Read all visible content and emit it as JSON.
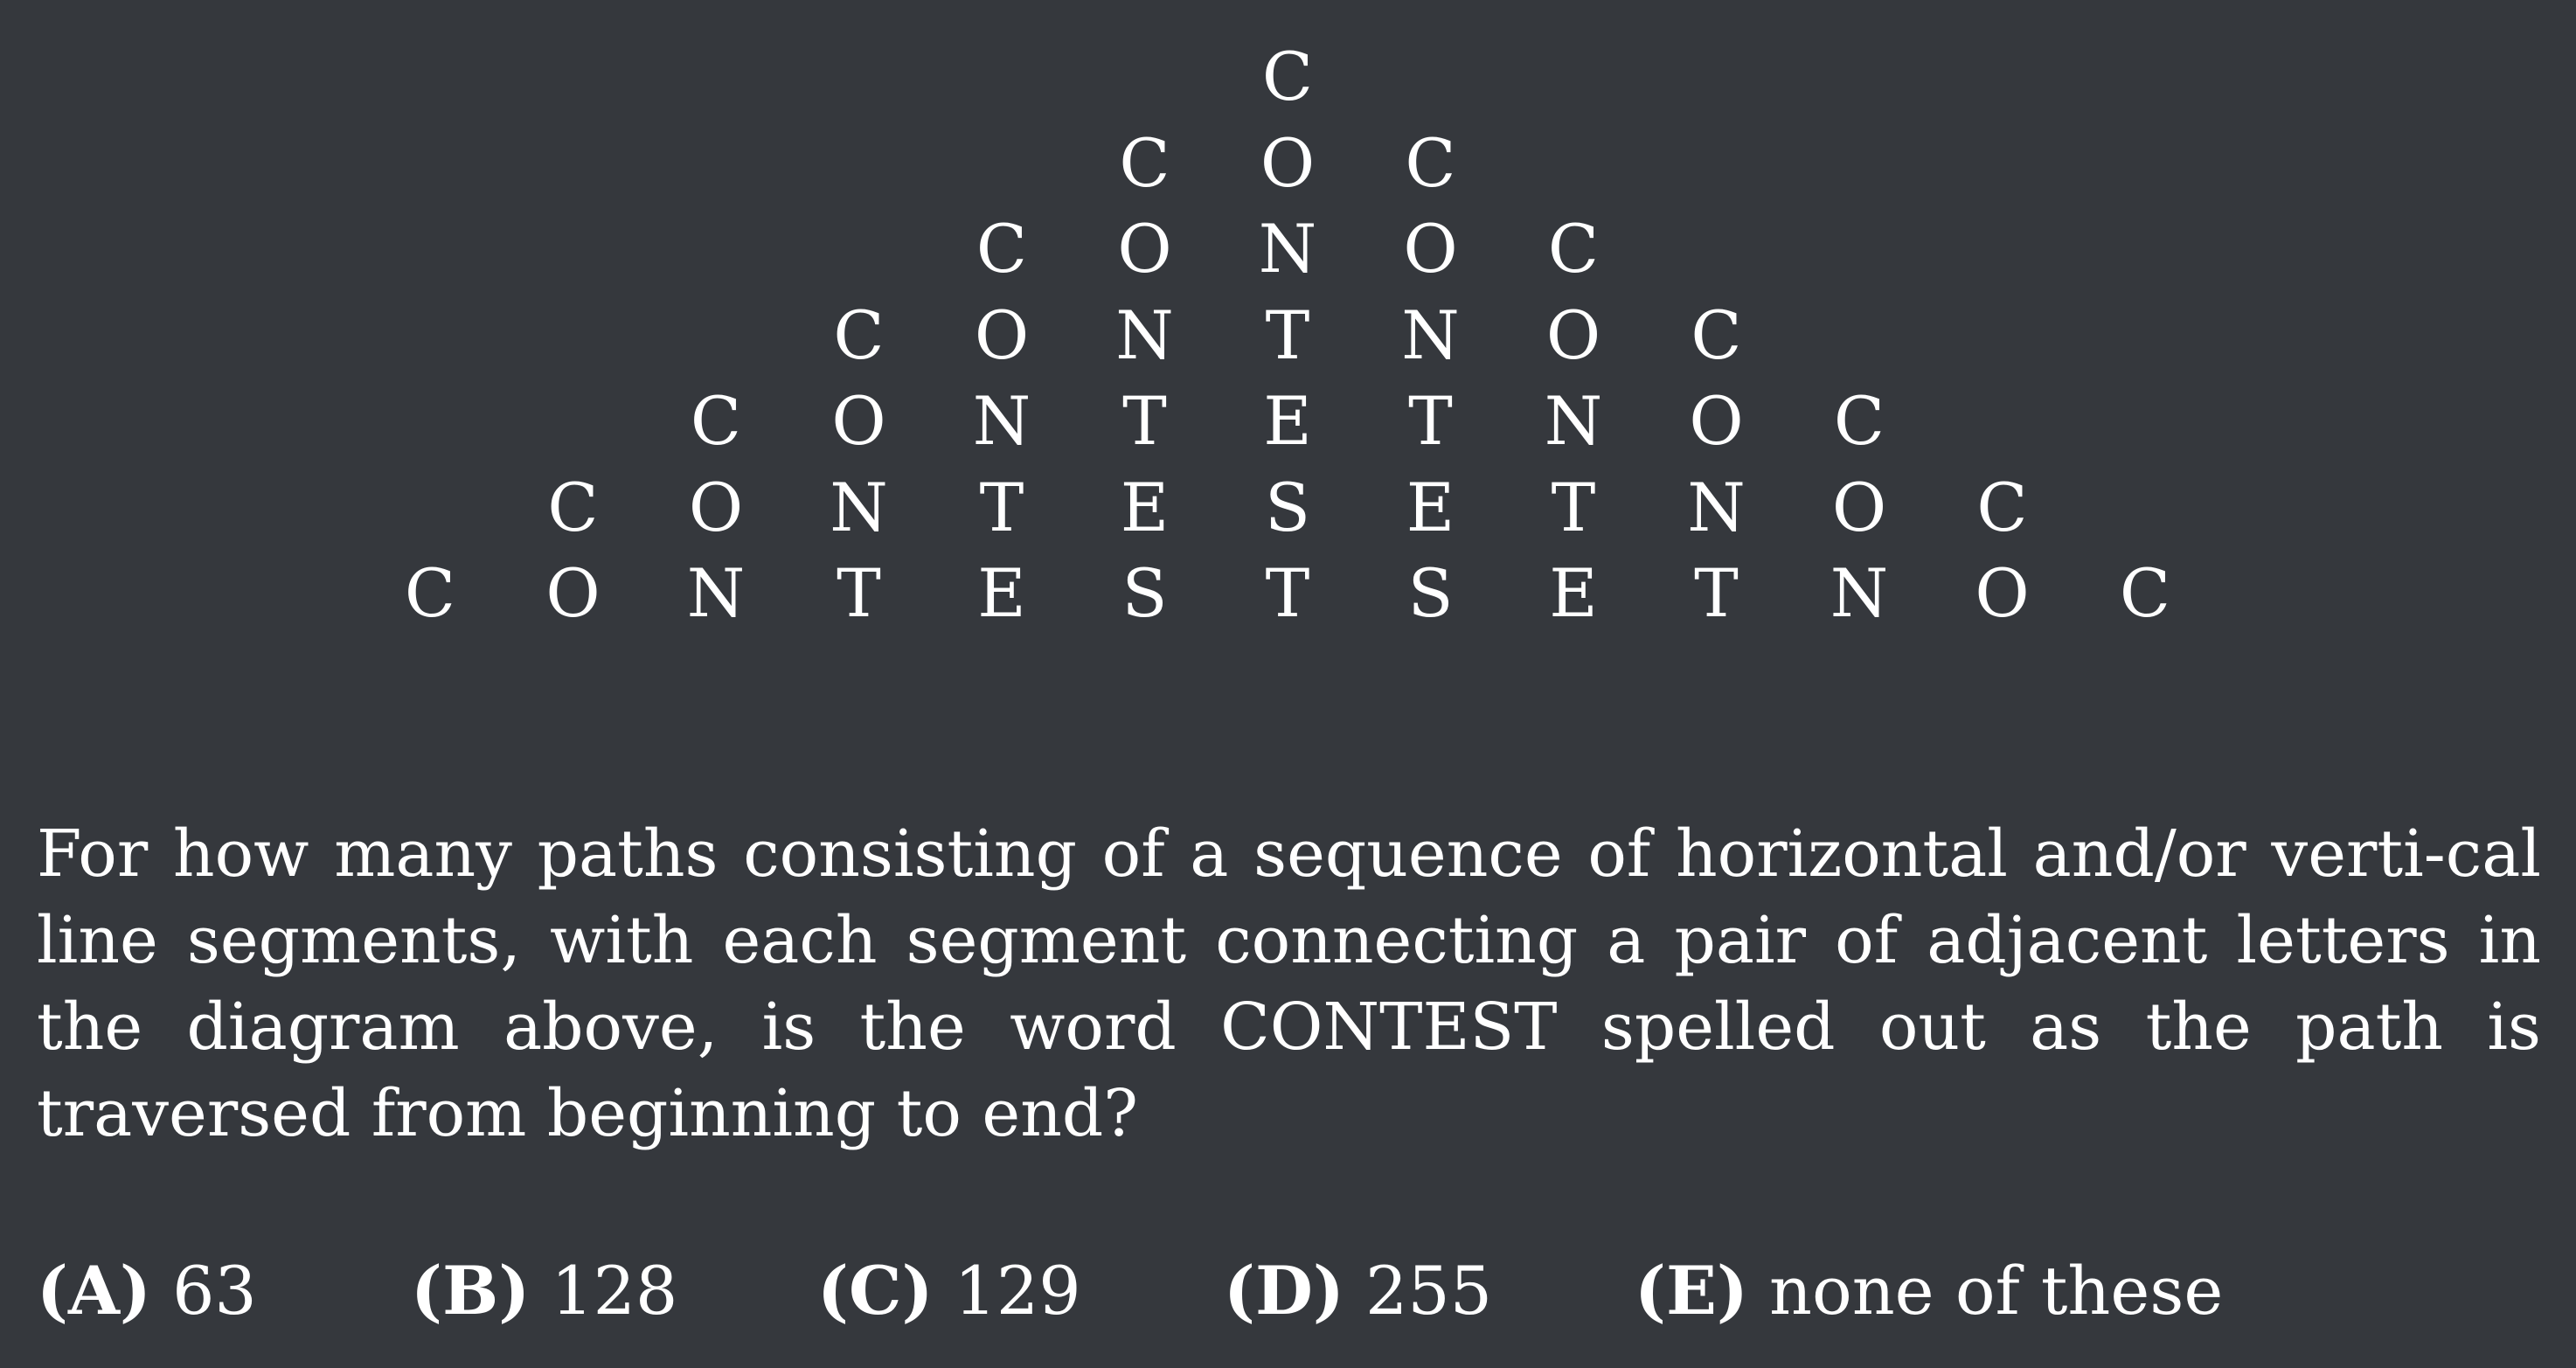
{
  "diagram": {
    "rows": [
      [
        "C"
      ],
      [
        "C",
        "O",
        "C"
      ],
      [
        "C",
        "O",
        "N",
        "O",
        "C"
      ],
      [
        "C",
        "O",
        "N",
        "T",
        "N",
        "O",
        "C"
      ],
      [
        "C",
        "O",
        "N",
        "T",
        "E",
        "T",
        "N",
        "O",
        "C"
      ],
      [
        "C",
        "O",
        "N",
        "T",
        "E",
        "S",
        "E",
        "T",
        "N",
        "O",
        "C"
      ],
      [
        "C",
        "O",
        "N",
        "T",
        "E",
        "S",
        "T",
        "S",
        "E",
        "T",
        "N",
        "O",
        "C"
      ]
    ]
  },
  "question": {
    "text": "For how many paths consisting of a sequence of horizontal and/or verti-cal line segments, with each segment connecting a pair of adjacent letters in the diagram above, is the word CONTEST spelled out as the path is traversed from beginning to end?"
  },
  "choices": [
    {
      "label": "(A)",
      "value": "63"
    },
    {
      "label": "(B)",
      "value": "128"
    },
    {
      "label": "(C)",
      "value": "129"
    },
    {
      "label": "(D)",
      "value": "255"
    },
    {
      "label": "(E)",
      "value": "none of these"
    }
  ]
}
